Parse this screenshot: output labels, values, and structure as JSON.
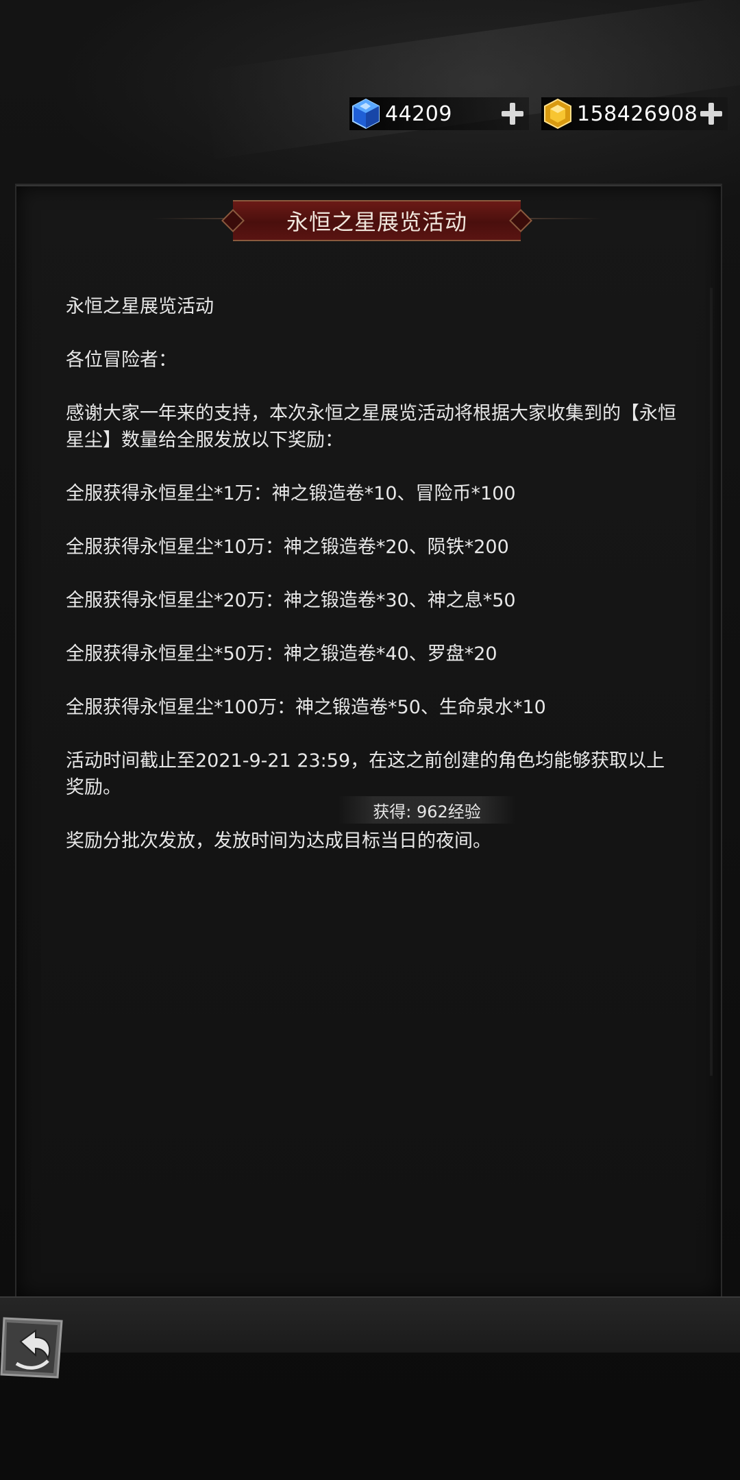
{
  "currency": {
    "gems": {
      "amount": "44209",
      "icon": "blue-gem-icon"
    },
    "gold": {
      "amount": "158426908",
      "icon": "gold-gem-icon"
    }
  },
  "panel": {
    "title": "永恒之星展览活动"
  },
  "content": {
    "lines": [
      "永恒之星展览活动",
      "各位冒险者：",
      "感谢大家一年来的支持，本次永恒之星展览活动将根据大家收集到的【永恒星尘】数量给全服发放以下奖励：",
      "全服获得永恒星尘*1万：神之锻造卷*10、冒险币*100",
      "全服获得永恒星尘*10万：神之锻造卷*20、陨铁*200",
      "全服获得永恒星尘*20万：神之锻造卷*30、神之息*50",
      "全服获得永恒星尘*50万：神之锻造卷*40、罗盘*20",
      "全服获得永恒星尘*100万：神之锻造卷*50、生命泉水*10",
      "活动时间截止至2021-9-21 23:59，在这之前创建的角色均能够获取以上奖励。",
      "奖励分批次发放，发放时间为达成目标当日的夜间。"
    ]
  },
  "toast": {
    "text": "获得: 962经验"
  },
  "back_button": {
    "icon": "back-arrow-icon"
  }
}
